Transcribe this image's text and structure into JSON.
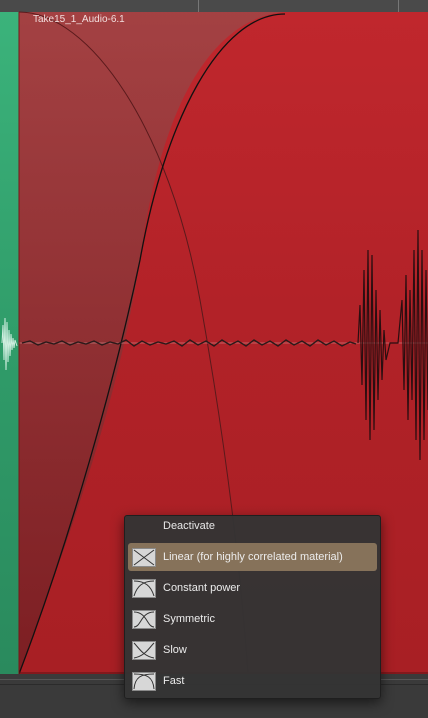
{
  "region": {
    "title": "Take15_1_Audio-6.1"
  },
  "crossfade_menu": {
    "header_label": "Deactivate",
    "items": [
      {
        "label": "Linear (for highly correlated material)",
        "icon": "linear-curve-icon",
        "selected": true
      },
      {
        "label": "Constant power",
        "icon": "constant-power-curve-icon",
        "selected": false
      },
      {
        "label": "Symmetric",
        "icon": "symmetric-curve-icon",
        "selected": false
      },
      {
        "label": "Slow",
        "icon": "slow-curve-icon",
        "selected": false
      },
      {
        "label": "Fast",
        "icon": "fast-curve-icon",
        "selected": false
      }
    ]
  },
  "colors": {
    "region_red": "#b22228",
    "region_green": "#2f9a68",
    "menu_highlight": "#86725a"
  }
}
